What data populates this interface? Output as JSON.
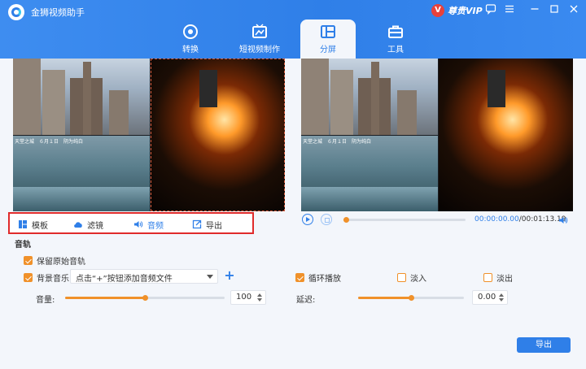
{
  "app": {
    "title": "金狮视频助手",
    "vip_label": "尊贵VIP"
  },
  "window_controls": [
    "message-icon",
    "menu-icon",
    "minimize-icon",
    "maximize-icon",
    "close-icon"
  ],
  "tabs": [
    {
      "label": "转换",
      "icon": "convert-icon",
      "active": false
    },
    {
      "label": "短视频制作",
      "icon": "short-video-icon",
      "active": false
    },
    {
      "label": "分屏",
      "icon": "split-screen-icon",
      "active": true
    },
    {
      "label": "工具",
      "icon": "toolbox-icon",
      "active": false
    }
  ],
  "preview": {
    "caption": "天堂之城　６月１日　阴为纯白"
  },
  "toolbar": {
    "items": [
      {
        "label": "模板",
        "icon": "template-icon",
        "active": false
      },
      {
        "label": "滤镜",
        "icon": "filter-icon",
        "active": false
      },
      {
        "label": "音频",
        "icon": "audio-icon",
        "active": true
      },
      {
        "label": "导出",
        "icon": "export-icon",
        "active": false
      }
    ]
  },
  "player": {
    "current_time": "00:00:00.00",
    "total_time": "/00:01:13.19",
    "progress": 0.02
  },
  "audio": {
    "section_title": "音轨",
    "keep_original": {
      "label": "保留原始音轨",
      "checked": true
    },
    "bg_music": {
      "label": "背景音乐",
      "checked": true
    },
    "bg_music_select": "点击“+”按钮添加音频文件",
    "loop": {
      "label": "循环播放",
      "checked": true
    },
    "fade_in": {
      "label": "淡入",
      "checked": false
    },
    "fade_out": {
      "label": "淡出",
      "checked": false
    },
    "volume_label": "音量:",
    "volume_value": "100",
    "volume_level": 0.5,
    "delay_label": "延迟:",
    "delay_value": "0.00",
    "delay_level": 0.5
  },
  "export_button": "导出",
  "colors": {
    "accent": "#2f7fe8",
    "orange": "#f0912a",
    "highlight": "#e02b2b"
  }
}
